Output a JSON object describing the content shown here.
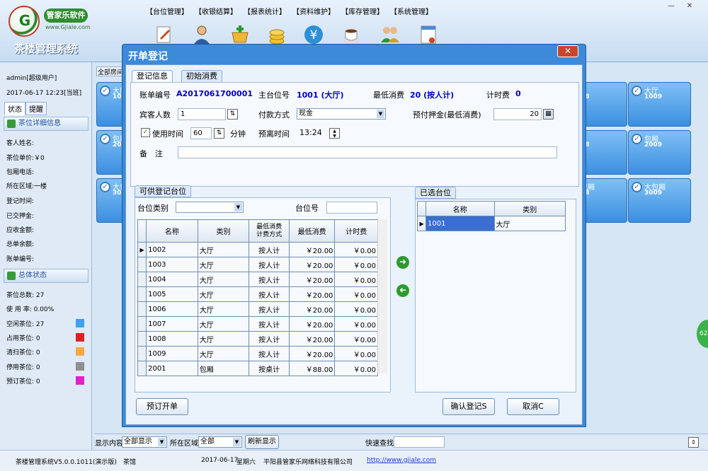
{
  "window": {
    "brand_name": "管家乐软件",
    "brand_url": "www.Gjiale.com",
    "logo_letter": "G",
    "app_title": "茶楼管理系统",
    "menu": [
      "【台位管理】",
      "【收银结算】",
      "【报表统计】",
      "【资料维护】",
      "【库存管理】",
      "【系统管理】"
    ],
    "toolbar_icons": [
      "edit-icon",
      "user-icon",
      "basket-icon",
      "coins-icon",
      "yen-icon",
      "coffee-icon",
      "users-icon",
      "document-icon"
    ]
  },
  "left_panel": {
    "user": "admin[超级用户]",
    "datetime": "2017-06-17 12:23[当班]",
    "tabs": [
      "状态",
      "提醒"
    ],
    "detail_header": "茶位详细信息",
    "detail_fields": [
      "客人姓名:",
      "茶位单价:￥0",
      "包厢电话:",
      "所在区域:一楼",
      "登记时间:",
      "已交押金:",
      "应收金额:",
      "总单余额:",
      "账单编号:"
    ],
    "summary_header": "总体状态",
    "summary_fields": [
      "茶位总数: 27",
      "使 用 率: 0.00%"
    ],
    "legend": [
      {
        "label": "空闲茶位: 27",
        "color": "#3fa0f0"
      },
      {
        "label": "占用茶位: 0",
        "color": "#e02020"
      },
      {
        "label": "清扫茶位: 0",
        "color": "#f5a845"
      },
      {
        "label": "停用茶位: 0",
        "color": "#8f8f8f"
      },
      {
        "label": "预订茶位: 0",
        "color": "#e020c8"
      }
    ]
  },
  "grid": {
    "tab_label": "全部房间",
    "cards": [
      {
        "name": "大厅",
        "no": "100"
      },
      {
        "name": "包厢",
        "no": "200"
      },
      {
        "name": "大包",
        "no": "300"
      },
      {
        "name": "",
        "no": "08"
      },
      {
        "name": "大厅",
        "no": "1009"
      },
      {
        "name": "",
        "no": "08"
      },
      {
        "name": "包厢",
        "no": "2009"
      },
      {
        "name": "包厢",
        "no": "08"
      },
      {
        "name": "大包厢",
        "no": "3009"
      }
    ],
    "side_badge": "62"
  },
  "dialog": {
    "title": "开单登记",
    "close": "✕",
    "tabs": [
      "登记信息",
      "初始消费"
    ],
    "bill_no_label": "账单编号",
    "bill_no": "A2017061700001",
    "main_seat_label": "主台位号",
    "main_seat": "1001 (大厅)",
    "min_consume_label": "最低消费",
    "min_consume": "20 (按人计)",
    "time_fee_label": "计时费",
    "time_fee": "0",
    "guests_label": "宾客人数",
    "guests": "1",
    "payment_label": "付款方式",
    "payment": "现金",
    "deposit_label": "预付押金(最低消费)",
    "deposit": "20",
    "use_time_label": "使用时间",
    "use_time_checked": true,
    "use_time": "60",
    "minutes_label": "分钟",
    "leave_time_label": "预离时间",
    "leave_time": "13:24",
    "remarks_label": "备　注",
    "remarks": "",
    "available_group": "可供登记台位",
    "seat_type_label": "台位类别",
    "seat_type": "",
    "seat_no_label": "台位号",
    "seat_no": "",
    "available_columns": [
      "名称",
      "类别",
      "最低消费\n计费方式",
      "最低消费",
      "计时费"
    ],
    "available_rows": [
      [
        "1002",
        "大厅",
        "按人计",
        "￥20.00",
        "￥0.00"
      ],
      [
        "1003",
        "大厅",
        "按人计",
        "￥20.00",
        "￥0.00"
      ],
      [
        "1004",
        "大厅",
        "按人计",
        "￥20.00",
        "￥0.00"
      ],
      [
        "1005",
        "大厅",
        "按人计",
        "￥20.00",
        "￥0.00"
      ],
      [
        "1006",
        "大厅",
        "按人计",
        "￥20.00",
        "￥0.00"
      ],
      [
        "1007",
        "大厅",
        "按人计",
        "￥20.00",
        "￥0.00"
      ],
      [
        "1008",
        "大厅",
        "按人计",
        "￥20.00",
        "￥0.00"
      ],
      [
        "1009",
        "大厅",
        "按人计",
        "￥20.00",
        "￥0.00"
      ],
      [
        "2001",
        "包厢",
        "按桌计",
        "￥88.00",
        "￥0.00"
      ]
    ],
    "selected_group": "已选台位",
    "selected_columns": [
      "名称",
      "类别"
    ],
    "selected_rows": [
      [
        "1001",
        "大厅"
      ]
    ],
    "btn_reserve": "预订开单",
    "btn_confirm": "确认登记S",
    "btn_cancel": "取消C"
  },
  "filterbar": {
    "display_label": "显示内容",
    "display": "全部显示",
    "area_label": "所在区域",
    "area": "全部",
    "refresh": "刷新显示",
    "search_label": "快速查找",
    "search": ""
  },
  "statusbar": {
    "version": "茶楼管理系统V5.0.0.1011(演示版)",
    "module": "茶馆",
    "date": "2017-06-17",
    "weekday": "星期六",
    "company": "平阳县管家乐网络科技有限公司",
    "url": "http://www.gjiale.com"
  }
}
